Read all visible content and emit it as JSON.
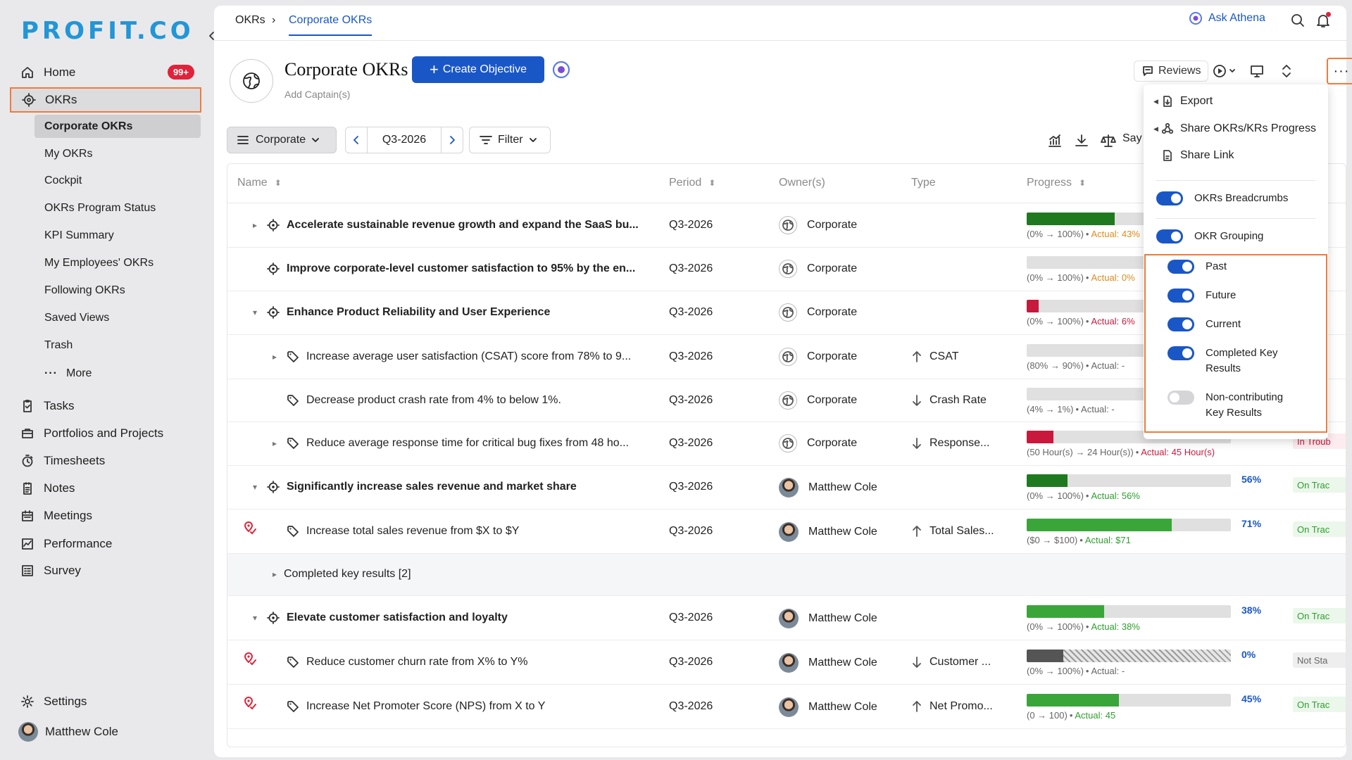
{
  "brand": {
    "logo_text": "PROFIT.CO"
  },
  "sidebar": {
    "home": {
      "label": "Home",
      "badge": "99+"
    },
    "okrs": {
      "label": "OKRs"
    },
    "okr_subitems": [
      "Corporate OKRs",
      "My OKRs",
      "Cockpit",
      "OKRs Program Status",
      "KPI Summary",
      "My Employees' OKRs",
      "Following OKRs",
      "Saved Views",
      "Trash"
    ],
    "more_label": "More",
    "main_items": [
      {
        "label": "Tasks",
        "icon": "tasks-icon"
      },
      {
        "label": "Portfolios and Projects",
        "icon": "portfolio-icon"
      },
      {
        "label": "Timesheets",
        "icon": "timesheet-icon"
      },
      {
        "label": "Notes",
        "icon": "notes-icon"
      },
      {
        "label": "Meetings",
        "icon": "calendar-icon"
      },
      {
        "label": "Performance",
        "icon": "performance-icon"
      },
      {
        "label": "Survey",
        "icon": "survey-icon"
      }
    ],
    "settings_label": "Settings",
    "user_name": "Matthew Cole"
  },
  "topbar": {
    "breadcrumb_root": "OKRs",
    "breadcrumb_sep": "›",
    "breadcrumb_current": "Corporate OKRs",
    "ask_athena": "Ask Athena"
  },
  "header": {
    "title": "Corporate OKRs",
    "add_captains": "Add Captain(s)",
    "create_button": "Create Objective",
    "reviews_label": "Reviews",
    "more_label": "···"
  },
  "filters": {
    "scope": "Corporate",
    "period": "Q3-2026",
    "filter_label": "Filter",
    "say_label": "Say"
  },
  "table": {
    "columns": {
      "name": "Name",
      "period": "Period",
      "owner": "Owner(s)",
      "type": "Type",
      "progress": "Progress"
    },
    "rows": [
      {
        "kind": "objective",
        "caret": "▸",
        "name": "Accelerate sustainable revenue growth and expand the SaaS bu...",
        "period": "Q3-2026",
        "owner": "Corporate",
        "owner_type": "org",
        "type": "",
        "type_dir": "",
        "progress": 43,
        "bar_color": "#1f7a1f",
        "range": "(0% → 100%)",
        "actual": "Actual: 43%",
        "actual_color": "#e08a1c",
        "pct": "",
        "status": "",
        "pin": false
      },
      {
        "kind": "objective",
        "caret": "",
        "name": "Improve corporate-level customer satisfaction to 95% by the en...",
        "period": "Q3-2026",
        "owner": "Corporate",
        "owner_type": "org",
        "type": "",
        "type_dir": "",
        "progress": 0,
        "bar_color": "#1f7a1f",
        "range": "(0% → 100%)",
        "actual": "Actual: 0%",
        "actual_color": "#e08a1c",
        "pct": "",
        "status": "",
        "pin": false
      },
      {
        "kind": "objective",
        "caret": "▾",
        "name": "Enhance Product Reliability and User Experience",
        "period": "Q3-2026",
        "owner": "Corporate",
        "owner_type": "org",
        "type": "",
        "type_dir": "",
        "progress": 6,
        "bar_color": "#c8193c",
        "range": "(0% → 100%)",
        "actual": "Actual: 6%",
        "actual_color": "#c8193c",
        "pct": "",
        "status": "",
        "pin": false
      },
      {
        "kind": "kr",
        "caret": "▸",
        "name": "Increase average user satisfaction (CSAT) score from 78% to 9...",
        "period": "Q3-2026",
        "owner": "Corporate",
        "owner_type": "org",
        "type": "CSAT",
        "type_dir": "up",
        "progress": 0,
        "bar_color": "#1f7a1f",
        "range": "(80% → 90%)",
        "actual": "Actual: -",
        "actual_color": "#666",
        "pct": "",
        "status": "",
        "pin": false
      },
      {
        "kind": "kr",
        "caret": "",
        "name": "Decrease product crash rate from 4% to below 1%.",
        "period": "Q3-2026",
        "owner": "Corporate",
        "owner_type": "org",
        "type": "Crash Rate",
        "type_dir": "down",
        "progress": 0,
        "bar_color": "#1f7a1f",
        "range": "(4% → 1%)",
        "actual": "Actual: -",
        "actual_color": "#666",
        "pct": "",
        "status": "",
        "pin": false
      },
      {
        "kind": "kr",
        "caret": "▸",
        "name": "Reduce average response time for critical bug fixes from 48 ho...",
        "period": "Q3-2026",
        "owner": "Corporate",
        "owner_type": "org",
        "type": "Response...",
        "type_dir": "down",
        "progress": 13,
        "bar_color": "#c8193c",
        "range": "(50 Hour(s) → 24 Hour(s))",
        "actual": "Actual: 45 Hour(s)",
        "actual_color": "#c8193c",
        "pct": "",
        "status": "In Troub",
        "status_color": "#c8193c",
        "status_bg": "#fdecef",
        "pin": false
      },
      {
        "kind": "objective",
        "caret": "▾",
        "name": "Significantly increase sales revenue and market share",
        "period": "Q3-2026",
        "owner": "Matthew Cole",
        "owner_type": "user",
        "type": "",
        "type_dir": "",
        "progress": 20,
        "bar_color": "#1f7a1f",
        "range": "(0% → 100%)",
        "actual": "Actual: 56%",
        "actual_color": "#2e9e2e",
        "pct": "56%",
        "status": "On Trac",
        "status_color": "#2e9e2e",
        "status_bg": "#eaf7ea",
        "pin": false
      },
      {
        "kind": "kr",
        "caret": "",
        "name": "Increase total sales revenue from $X to $Y",
        "period": "Q3-2026",
        "owner": "Matthew Cole",
        "owner_type": "user",
        "type": "Total Sales...",
        "type_dir": "up",
        "progress": 71,
        "bar_color": "#3aa63a",
        "range": "($0 → $100)",
        "actual": "Actual: $71",
        "actual_color": "#2e9e2e",
        "pct": "71%",
        "status": "On Trac",
        "status_color": "#2e9e2e",
        "status_bg": "#eaf7ea",
        "pin": true
      },
      {
        "kind": "group",
        "caret": "▸",
        "name": "Completed key results [2]"
      },
      {
        "kind": "objective",
        "caret": "▾",
        "name": "Elevate customer satisfaction and loyalty",
        "period": "Q3-2026",
        "owner": "Matthew Cole",
        "owner_type": "user",
        "type": "",
        "type_dir": "",
        "progress": 38,
        "bar_color": "#3aa63a",
        "range": "(0% → 100%)",
        "actual": "Actual: 38%",
        "actual_color": "#2e9e2e",
        "pct": "38%",
        "status": "On Trac",
        "status_color": "#2e9e2e",
        "status_bg": "#eaf7ea",
        "pin": false
      },
      {
        "kind": "kr",
        "caret": "",
        "name": "Reduce customer churn rate from X% to Y%",
        "period": "Q3-2026",
        "owner": "Matthew Cole",
        "owner_type": "user",
        "type": "Customer ...",
        "type_dir": "down",
        "progress": 0,
        "bar_color": "#555",
        "range": "(0% → 100%)",
        "actual": "Actual: -",
        "actual_color": "#666",
        "pct": "0%",
        "status": "Not Sta",
        "status_color": "#666",
        "status_bg": "#eeeeee",
        "pin": true,
        "hatched": true
      },
      {
        "kind": "kr",
        "caret": "",
        "name": "Increase Net Promoter Score (NPS) from X to Y",
        "period": "Q3-2026",
        "owner": "Matthew Cole",
        "owner_type": "user",
        "type": "Net Promo...",
        "type_dir": "up",
        "progress": 45,
        "bar_color": "#3aa63a",
        "range": "(0 → 100)",
        "actual": "Actual: 45",
        "actual_color": "#2e9e2e",
        "pct": "45%",
        "status": "On Trac",
        "status_color": "#2e9e2e",
        "status_bg": "#eaf7ea",
        "pin": true
      }
    ]
  },
  "menu": {
    "export": "Export",
    "share_progress": "Share OKRs/KRs Progress",
    "share_link": "Share Link",
    "toggles": [
      {
        "label": "OKRs Breadcrumbs",
        "on": true
      },
      {
        "label": "OKR Grouping",
        "on": true
      }
    ],
    "sub_toggles": [
      {
        "label": "Past",
        "on": true
      },
      {
        "label": "Future",
        "on": true
      },
      {
        "label": "Current",
        "on": true
      },
      {
        "label": "Completed Key Results",
        "on": true
      },
      {
        "label": "Non-contributing Key Results",
        "on": false
      }
    ]
  },
  "colors": {
    "accent": "#1a57c6",
    "highlight": "#f07b3c",
    "badge": "#e0223a",
    "logo": "#2196d8"
  }
}
